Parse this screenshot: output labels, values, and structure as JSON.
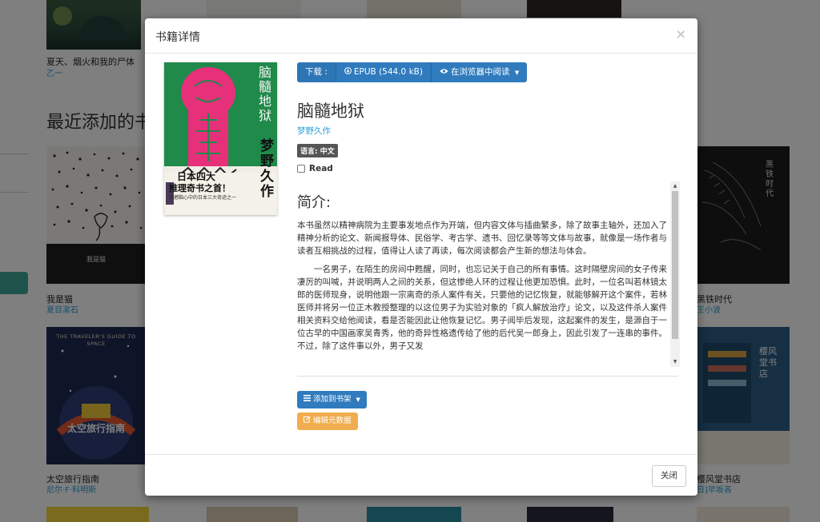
{
  "background": {
    "section_heading": "最近添加的书",
    "books": [
      {
        "title": "夏天、烟火和我的尸体",
        "author": "乙一"
      },
      {
        "title": "我是猫",
        "author": "夏目漱石"
      },
      {
        "title": "太空旅行指南",
        "author": "尼尔·F·科明斯"
      },
      {
        "title": "黑铁时代",
        "author": "王小波"
      },
      {
        "title": "樱风堂书店",
        "author": "日]早坂吝"
      }
    ],
    "cover_texts": {
      "cat_cover_title": "我是猫",
      "space_cover_title": "THE TRAVELER'S GUIDE TO SPACE",
      "space_cover_cn": "太空旅行指南",
      "iron_cover_title": "黑铁时代",
      "sakura_cover_title": "樱风堂书店"
    }
  },
  "modal": {
    "title": "书籍详情",
    "close_x": "×",
    "download": {
      "label": "下载 :",
      "epub": "EPUB (544.0 kB)",
      "read_in_browser": "在浏览器中阅读"
    },
    "book": {
      "title": "脑髓地狱",
      "author": "梦野久作",
      "language": "语言: 中文",
      "read_label": "Read"
    },
    "cover": {
      "big_title": "脑髓地狱",
      "author_vertical": "梦野久作",
      "tagline1": "日本四大",
      "tagline2": "推理奇书之首！",
      "tagline3": "震撼脑心中的日本三大奇迹之一"
    },
    "description": {
      "heading": "简介:",
      "paragraphs": [
        "本书虽然以精神病院为主要事发地点作为开端，但内容文体与插曲繁多，除了故事主轴外，还加入了精神分析的论文、新闻报导体、民俗学、考古学、遗书、回忆录等等文体与故事，就像是一场作者与读者互相挑战的过程，值得让人读了再读，每次阅读都会产生新的想法与体会。",
        "一名男子，在陌生的房间中甦醒，同时，也忘记关于自己的所有事情。这时隔壁房间的女子传来凄厉的叫喊，并说明两人之间的关系，但这惨绝人环的过程让他更加恐惧。此时，一位名叫若林镜太郎的医师现身，说明他跟一宗离奇的杀人案件有关，只要他的记忆恢复，就能够解开这个案件，若林医师并将另一位正木教授整理的以这位男子为实验对象的「疯人解放治疗」论文，以及这件杀人案件相关资料交给他阅读，看是否能因此让他恢复记忆。男子阅毕后发现，这起案件的发生，是源自于一位古早的中国画家吴青秀，他的奇异性格遗传给了他的后代吴一郎身上，因此引发了一连串的事件。不过，除了这件事以外，男子又发"
      ]
    },
    "add_to_shelf": "添加到书架",
    "edit_metadata": "编辑元数据",
    "close_button": "关闭"
  }
}
